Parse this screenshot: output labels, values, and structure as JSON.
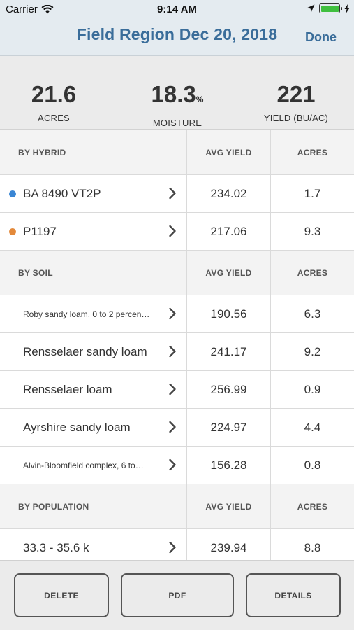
{
  "status": {
    "carrier": "Carrier",
    "time": "9:14 AM",
    "battery_level": 1.0
  },
  "nav": {
    "title": "Field Region Dec 20, 2018",
    "done": "Done"
  },
  "summary": {
    "acres": {
      "value": "21.6",
      "label": "ACRES"
    },
    "moisture": {
      "value": "18.3",
      "unit": "%",
      "label": "MOISTURE"
    },
    "yield": {
      "value": "221",
      "label": "YIELD (BU/AC)"
    }
  },
  "sections": {
    "hybrid": {
      "header": "BY HYBRID",
      "col_yield": "AVG YIELD",
      "col_acres": "ACRES",
      "rows": [
        {
          "name": "BA 8490 VT2P",
          "yield": "234.02",
          "acres": "1.7",
          "color": "#3a86d4"
        },
        {
          "name": "P1197",
          "yield": "217.06",
          "acres": "9.3",
          "color": "#e3893a"
        }
      ]
    },
    "soil": {
      "header": "BY SOIL",
      "col_yield": "AVG YIELD",
      "col_acres": "ACRES",
      "rows": [
        {
          "name": "Roby sandy loam, 0 to 2 percen…",
          "yield": "190.56",
          "acres": "6.3"
        },
        {
          "name": "Rensselaer sandy loam",
          "yield": "241.17",
          "acres": "9.2"
        },
        {
          "name": "Rensselaer loam",
          "yield": "256.99",
          "acres": "0.9"
        },
        {
          "name": "Ayrshire sandy loam",
          "yield": "224.97",
          "acres": "4.4"
        },
        {
          "name": "Alvin-Bloomfield complex, 6 to…",
          "yield": "156.28",
          "acres": "0.8"
        }
      ]
    },
    "population": {
      "header": "BY POPULATION",
      "col_yield": "AVG YIELD",
      "col_acres": "ACRES",
      "rows": [
        {
          "name": "33.3 - 35.6 k",
          "yield": "239.94",
          "acres": "8.8"
        }
      ]
    }
  },
  "actions": {
    "delete": "DELETE",
    "pdf": "PDF",
    "details": "DETAILS"
  },
  "icons": {
    "wifi": "wifi-icon",
    "location": "location-arrow-icon",
    "battery": "battery-icon",
    "charging": "charging-bolt-icon",
    "chevron": "chevron-right-icon"
  }
}
